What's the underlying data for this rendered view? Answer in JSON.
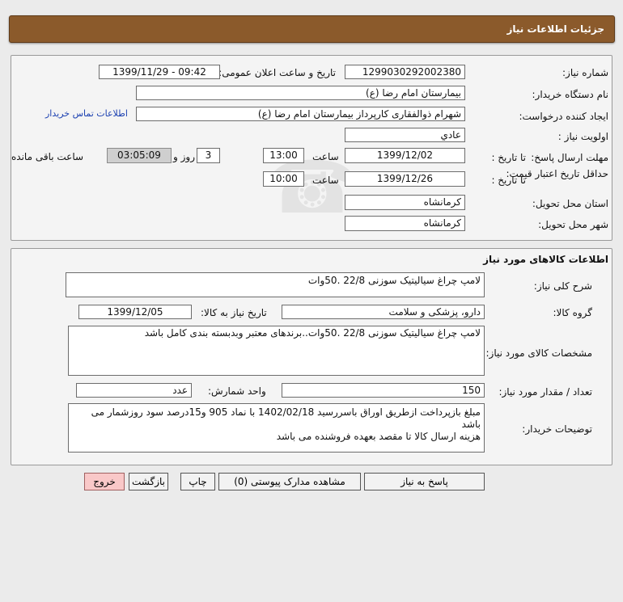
{
  "header": {
    "title": "جزئیات اطلاعات نیاز"
  },
  "info": {
    "need_number_label": "شماره نیاز:",
    "need_number": "1299030292002380",
    "announce_label": "تاریخ و ساعت اعلان عمومی:",
    "announce_value": "1399/11/29 - 09:42",
    "buyer_org_label": "نام دستگاه خریدار:",
    "buyer_org": "بیمارستان امام رضا (ع)",
    "requester_label": "ایجاد کننده درخواست:",
    "requester": "شهرام ذوالفقاری کارپرداز بیمارستان امام رضا (ع)",
    "contact_link": "اطلاعات تماس خریدار",
    "priority_label": "اولویت نیاز :",
    "priority": "عادي",
    "deadline_label": "مهلت ارسال پاسخ:",
    "until_date_label": "تا تاریخ :",
    "deadline_date": "1399/12/02",
    "time_label": "ساعت",
    "deadline_time": "13:00",
    "days_value": "3",
    "days_label": "روز و",
    "remaining_time": "03:05:09",
    "remaining_label": "ساعت باقی مانده",
    "validity_label": "حداقل تاریخ اعتبار قیمت:",
    "validity_date": "1399/12/26",
    "validity_time": "10:00",
    "province_label": "استان محل تحویل:",
    "province": "کرمانشاه",
    "city_label": "شهر محل تحویل:",
    "city": "کرمانشاه"
  },
  "goods": {
    "section_title": "اطلاعات کالاهای مورد نیاز",
    "general_desc_label": "شرح کلی نیاز:",
    "general_desc": "لامپ چراغ سیالیتیک سوزنی 22/8 .50وات",
    "group_label": "گروه کالا:",
    "group": "دارو، پزشکی و سلامت",
    "need_date_label": "تاریخ نیاز به کالا:",
    "need_date": "1399/12/05",
    "spec_label": "مشخصات کالای مورد نیاز:",
    "spec": "لامپ چراغ سیالیتیک سوزنی 22/8 .50وات..برندهای معتبر وبدبسته بندی کامل باشد",
    "quantity_label": "تعداد / مقدار مورد نیاز:",
    "quantity": "150",
    "unit_label": "واحد شمارش:",
    "unit": "عدد",
    "buyer_notes_label": "توضیحات خریدار:",
    "buyer_notes_line1": "مبلغ بازپرداخت ازطریق اوراق باسررسید 1402/02/18 با نماد 905 و15درصد سود روزشمار می باشد",
    "buyer_notes_line2": "هزینه ارسال کالا تا مقصد بعهده فروشنده می باشد"
  },
  "buttons": {
    "reply": "پاسخ به نیاز",
    "attachments": "مشاهده مدارک پیوستی (0)",
    "print": "چاپ",
    "back": "بازگشت",
    "exit": "خروج"
  },
  "colors": {
    "header_bg": "#8b5a2b",
    "exit_button_bg": "#f9c8c8",
    "link": "#1a3fb0"
  }
}
